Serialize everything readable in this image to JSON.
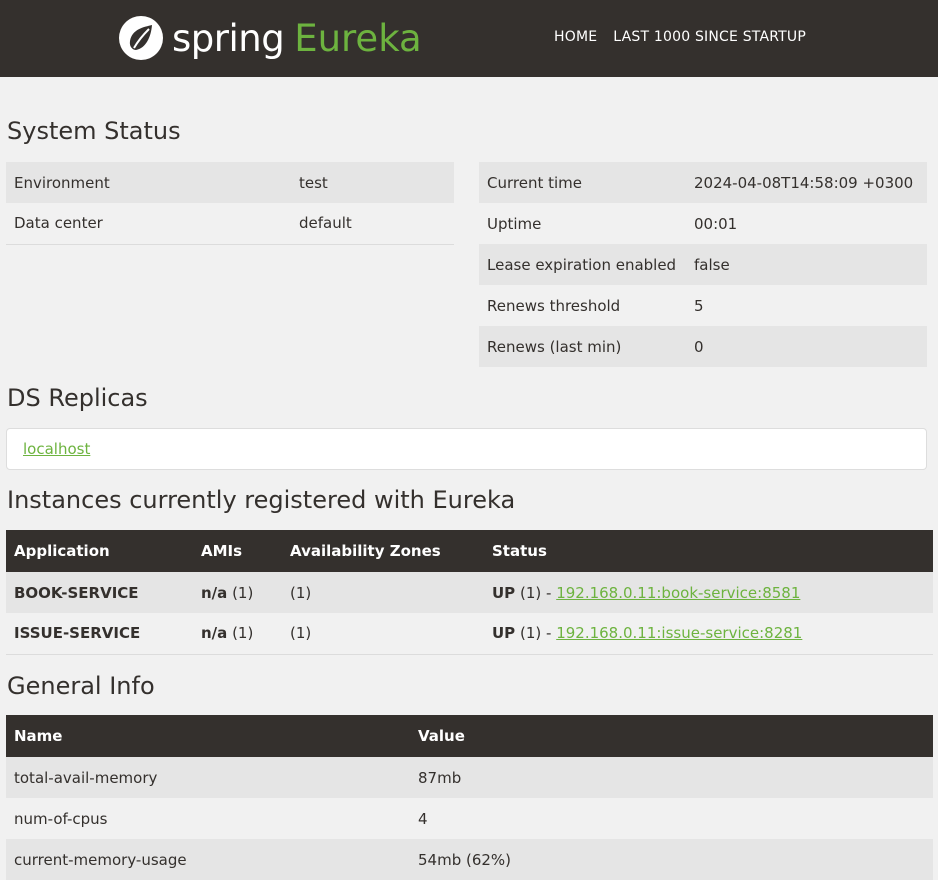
{
  "header": {
    "brand_spring": "spring",
    "brand_eureka": "Eureka",
    "nav": [
      {
        "label": "HOME"
      },
      {
        "label": "LAST 1000 SINCE STARTUP"
      }
    ]
  },
  "system_status": {
    "title": "System Status",
    "left": [
      {
        "label": "Environment",
        "value": "test"
      },
      {
        "label": "Data center",
        "value": "default"
      }
    ],
    "right": [
      {
        "label": "Current time",
        "value": "2024-04-08T14:58:09 +0300"
      },
      {
        "label": "Uptime",
        "value": "00:01"
      },
      {
        "label": "Lease expiration enabled",
        "value": "false"
      },
      {
        "label": "Renews threshold",
        "value": "5"
      },
      {
        "label": "Renews (last min)",
        "value": "0"
      }
    ]
  },
  "replicas": {
    "title": "DS Replicas",
    "link": "localhost"
  },
  "instances": {
    "title": "Instances currently registered with Eureka",
    "headers": [
      "Application",
      "AMIs",
      "Availability Zones",
      "Status"
    ],
    "rows": [
      {
        "application": "BOOK-SERVICE",
        "ami": "n/a",
        "ami_count": "(1)",
        "zones": "(1)",
        "status": "UP",
        "status_count": "(1) -",
        "link": "192.168.0.11:book-service:8581"
      },
      {
        "application": "ISSUE-SERVICE",
        "ami": "n/a",
        "ami_count": "(1)",
        "zones": "(1)",
        "status": "UP",
        "status_count": "(1) -",
        "link": "192.168.0.11:issue-service:8281"
      }
    ]
  },
  "general_info": {
    "title": "General Info",
    "headers": [
      "Name",
      "Value"
    ],
    "rows": [
      {
        "name": "total-avail-memory",
        "value": "87mb"
      },
      {
        "name": "num-of-cpus",
        "value": "4"
      },
      {
        "name": "current-memory-usage",
        "value": "54mb (62%)"
      }
    ]
  },
  "colors": {
    "header_bg": "#34302d",
    "accent": "#6db33f",
    "page_bg": "#f1f1f1"
  }
}
